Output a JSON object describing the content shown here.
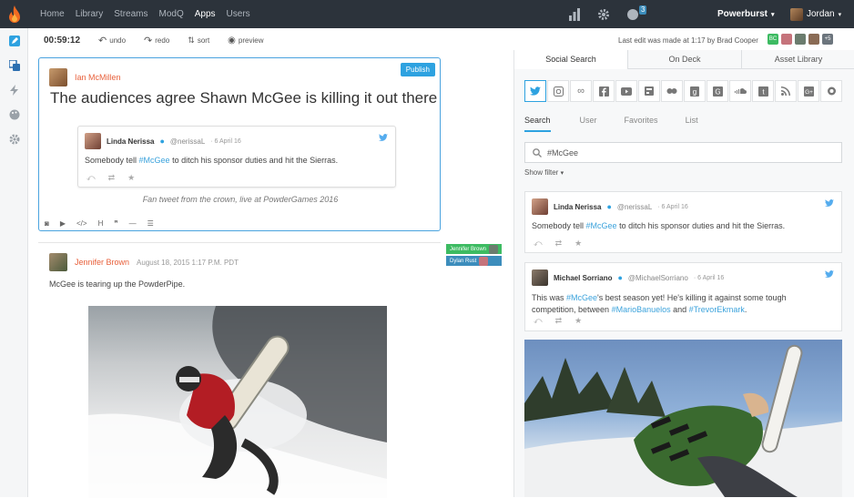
{
  "nav": {
    "items": [
      "Home",
      "Library",
      "Streams",
      "ModQ",
      "Apps",
      "Users"
    ],
    "active": "Apps",
    "notifications_count": "3",
    "org_name": "Powerburst",
    "user_name": "Jordan"
  },
  "toolbar": {
    "timer": "00:59:12",
    "undo": "undo",
    "redo": "redo",
    "sort": "sort",
    "preview": "preview",
    "last_edit": "Last edit was made at 1:17 by Brad Cooper",
    "collaborators_initials": "BC",
    "more_collaborators": "+5"
  },
  "editor": {
    "publish_label": "Publish",
    "author": "Ian McMillen",
    "headline": "The audiences agree Shawn McGee is killing it out there",
    "embedded_tweet": {
      "name": "Linda Nerissa",
      "handle": "@nerissaL",
      "date": "6 April 16",
      "text_before": "Somebody tell ",
      "hashtag": "#McGee",
      "text_after": " to ditch his sponsor duties and hit the Sierras."
    },
    "caption": "Fan tweet from the crown, live at PowderGames 2016"
  },
  "post2": {
    "author": "Jennifer Brown",
    "meta": "August 18, 2015 1:17 P.M. PDT",
    "text": "McGee is tearing up the PowderPipe."
  },
  "lanes": [
    {
      "label": "Jennifer Brown",
      "color": "#3dbb62"
    },
    {
      "label": "Dylan Rust",
      "color": "#3c8dbc"
    }
  ],
  "right_panel": {
    "tabs": [
      "Social Search",
      "On Deck",
      "Asset Library"
    ],
    "active_tab": "Social Search",
    "sub_tabs": [
      "Search",
      "User",
      "Favorites",
      "List"
    ],
    "active_sub_tab": "Search",
    "search_value": "#McGee",
    "show_filter": "Show filter",
    "results": [
      {
        "name": "Linda Nerissa",
        "handle": "@nerissaL",
        "date": "6 April 16",
        "text_before": "Somebody tell ",
        "hashtag": "#McGee",
        "text_after": " to ditch his sponsor duties and hit the Sierras."
      },
      {
        "name": "Michael Sorriano",
        "handle": "@MichaelSorriano",
        "date": "6 April 16",
        "line1_before": "This was ",
        "line1_hashtag": "#McGee",
        "line1_after": "'s best season yet! He's killing it against some tough",
        "line2_before": "competition, between ",
        "line2_hashtag1": "#MarioBanuelos",
        "line2_mid": " and ",
        "line2_hashtag2": "#TrevorEkmark",
        "line2_after": "."
      }
    ]
  },
  "colors": {
    "topbar": "#2c333b",
    "accent": "#2ea2e0",
    "author_red": "#e8613c",
    "hashtag": "#3ca3dc"
  }
}
